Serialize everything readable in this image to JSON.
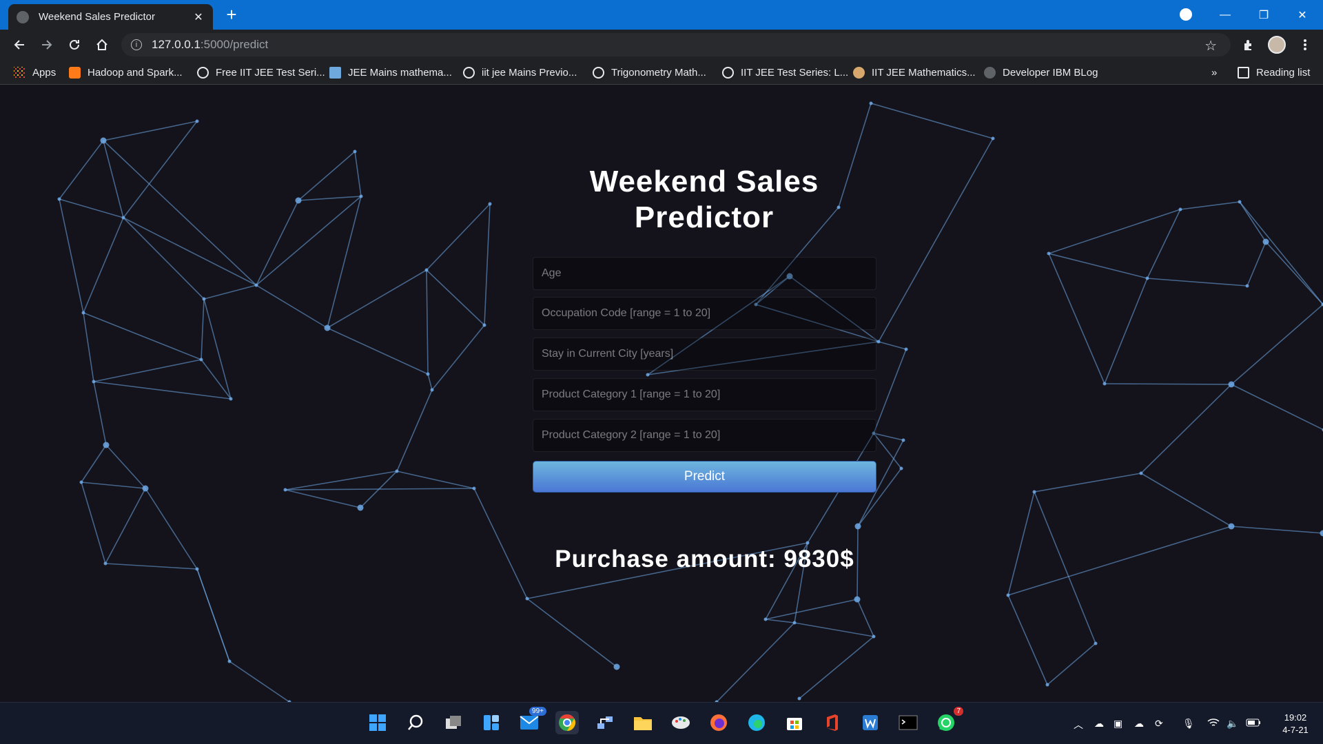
{
  "browser": {
    "tab_title": "Weekend Sales Predictor",
    "url_host": "127.0.0.1",
    "url_path": ":5000/predict"
  },
  "bookmarks": {
    "items": [
      {
        "label": "Apps",
        "icon": "apps-grid-icon"
      },
      {
        "label": "Hadoop and Spark...",
        "icon": "blogger-icon"
      },
      {
        "label": "Free IIT JEE Test Seri...",
        "icon": "globe-icon"
      },
      {
        "label": "JEE Mains mathema...",
        "icon": "site-icon"
      },
      {
        "label": "iit jee Mains Previo...",
        "icon": "globe-icon"
      },
      {
        "label": "Trigonometry Math...",
        "icon": "globe-icon"
      },
      {
        "label": "IIT JEE Test Series: L...",
        "icon": "globe-icon"
      },
      {
        "label": "IIT JEE Mathematics...",
        "icon": "owl-icon"
      },
      {
        "label": "Developer IBM BLog",
        "icon": "bee-icon"
      }
    ],
    "overflow": "»",
    "reading_list": "Reading list"
  },
  "page": {
    "heading": "Weekend Sales Predictor",
    "fields": {
      "age_placeholder": "Age",
      "occupation_placeholder": "Occupation Code [range = 1 to 20]",
      "stay_placeholder": "Stay in Current City [years]",
      "product1_placeholder": "Product Category 1 [range = 1 to 20]",
      "product2_placeholder": "Product Category 2 [range = 1 to 20]"
    },
    "predict_button": "Predict",
    "result": "Purchase amount: 9830$"
  },
  "taskbar": {
    "mail_badge": "99+",
    "whatsapp_badge": "7",
    "time": "19:02",
    "date": "4-7-21"
  },
  "colors": {
    "tab_strip": "#0a6fd1",
    "page_bg": "#14121b",
    "button_gradient_top": "#6eb6de",
    "button_gradient_bottom": "#4a77d4",
    "network_lines": "#6ea9e6"
  }
}
